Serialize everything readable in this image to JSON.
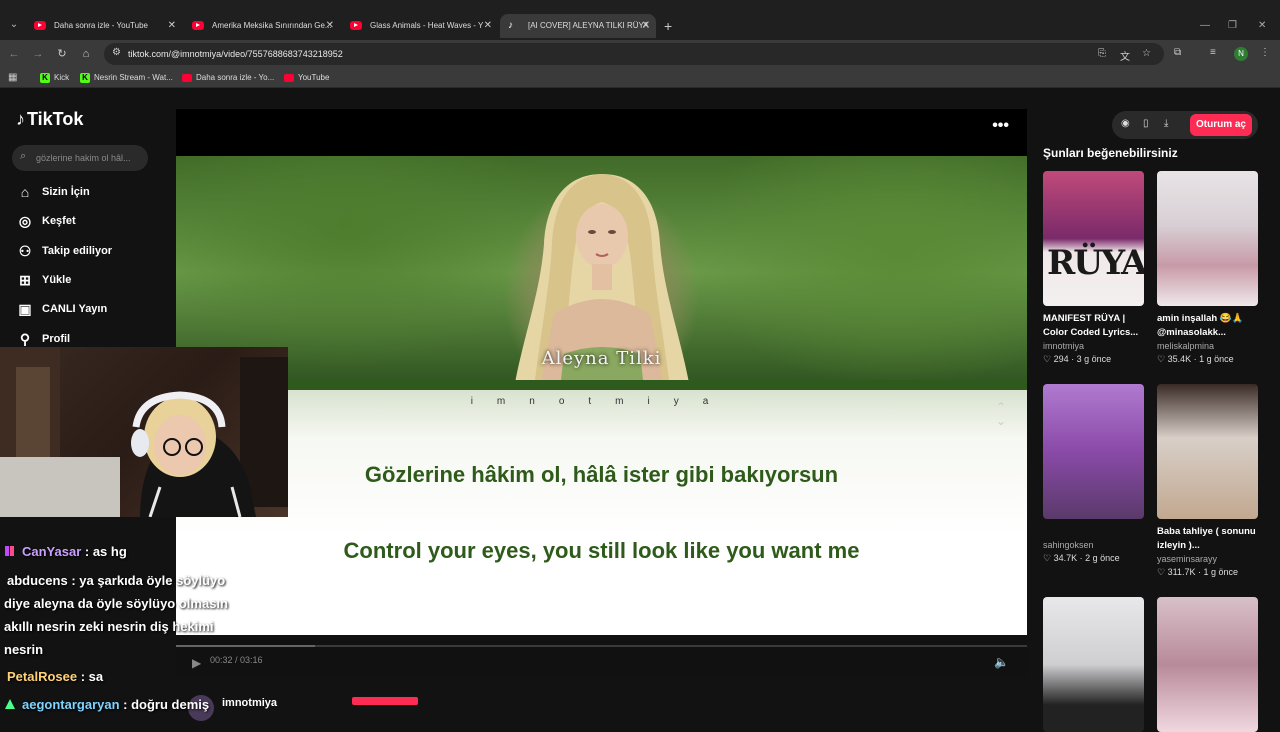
{
  "browser": {
    "tabs": [
      {
        "title": "Daha sonra izle - YouTube",
        "icon": "youtube-icon"
      },
      {
        "title": "Amerika Meksika Sınırından Ge...",
        "icon": "youtube-icon"
      },
      {
        "title": "Glass Animals - Heat Waves - Y",
        "icon": "youtube-icon"
      },
      {
        "title": "[AI COVER] ALEYNA TILKI RÜYA",
        "icon": "tiktok-icon"
      }
    ],
    "url": "tiktok.com/@imnotmiya/video/7557688683743218952",
    "bookmarks": [
      {
        "label": "Kick"
      },
      {
        "label": "Nesrin Stream - Wat..."
      },
      {
        "label": "Daha sonra izle - Yo..."
      },
      {
        "label": "YouTube"
      }
    ],
    "profile_initial": "N"
  },
  "tiktok": {
    "logo": "TikTok",
    "search_placeholder": "gözlerine hakim ol hâl...",
    "nav": [
      {
        "label": "Sizin İçin",
        "icon": "home-icon"
      },
      {
        "label": "Keşfet",
        "icon": "compass-icon"
      },
      {
        "label": "Takip ediliyor",
        "icon": "following-icon"
      },
      {
        "label": "Yükle",
        "icon": "upload-icon"
      },
      {
        "label": "CANLI Yayın",
        "icon": "live-icon"
      },
      {
        "label": "Profil",
        "icon": "profile-icon"
      }
    ],
    "login_label": "Oturum aç",
    "video": {
      "artist_overlay": "Aleyna Tilki",
      "watermark": "imnotmiya",
      "lyric_tr": "Gözlerine hâkim ol, hâlâ ister gibi bakıyorsun",
      "lyric_en": "Control your eyes, you still look like you want me",
      "time": "00:32 / 03:16",
      "progress": 0.163,
      "creator": "imnotmiya"
    },
    "suggest_title": "Şunları beğenebilirsiniz",
    "recommendations": [
      {
        "caption": "MANIFEST RÜYA | Color Coded Lyrics...",
        "user": "imnotmiya",
        "likes": "294",
        "age": "3 g önce"
      },
      {
        "caption": "amin inşallah 😂🙏 @minasolakk...",
        "user": "meliskalpmina",
        "likes": "35.4K",
        "age": "1 g önce"
      },
      {
        "caption": "",
        "user": "sahingoksen",
        "likes": "34.7K",
        "age": "2 g önce"
      },
      {
        "caption": "Baba tahliye ( sonunu izleyin )...",
        "user": "yaseminsarayy",
        "likes": "311.7K",
        "age": "1 g önce"
      }
    ]
  },
  "chat": [
    {
      "user": "CanYasar",
      "user_color": "#c9a0ff",
      "message": ": as hg"
    },
    {
      "user": "abducens",
      "user_color": "#ffffff",
      "message": ": ya şarkıda öyle söylüyo"
    },
    {
      "user": "",
      "user_color": "#ffffff",
      "message": "diye aleyna da öyle söylüyo olmasın"
    },
    {
      "user": "",
      "user_color": "#ffffff",
      "message": "akıllı nesrin zeki nesrin diş hekimi"
    },
    {
      "user": "",
      "user_color": "#ffffff",
      "message": "nesrin"
    },
    {
      "user": "PetalRosee",
      "user_color": "#ffd27a",
      "message": ": sa"
    },
    {
      "user": "aegontargaryan",
      "user_color": "#7fd4ff",
      "message": ": doğru demiş"
    }
  ],
  "colors": {
    "accent": "#fe2c55",
    "lyric": "#2e5a1a"
  }
}
